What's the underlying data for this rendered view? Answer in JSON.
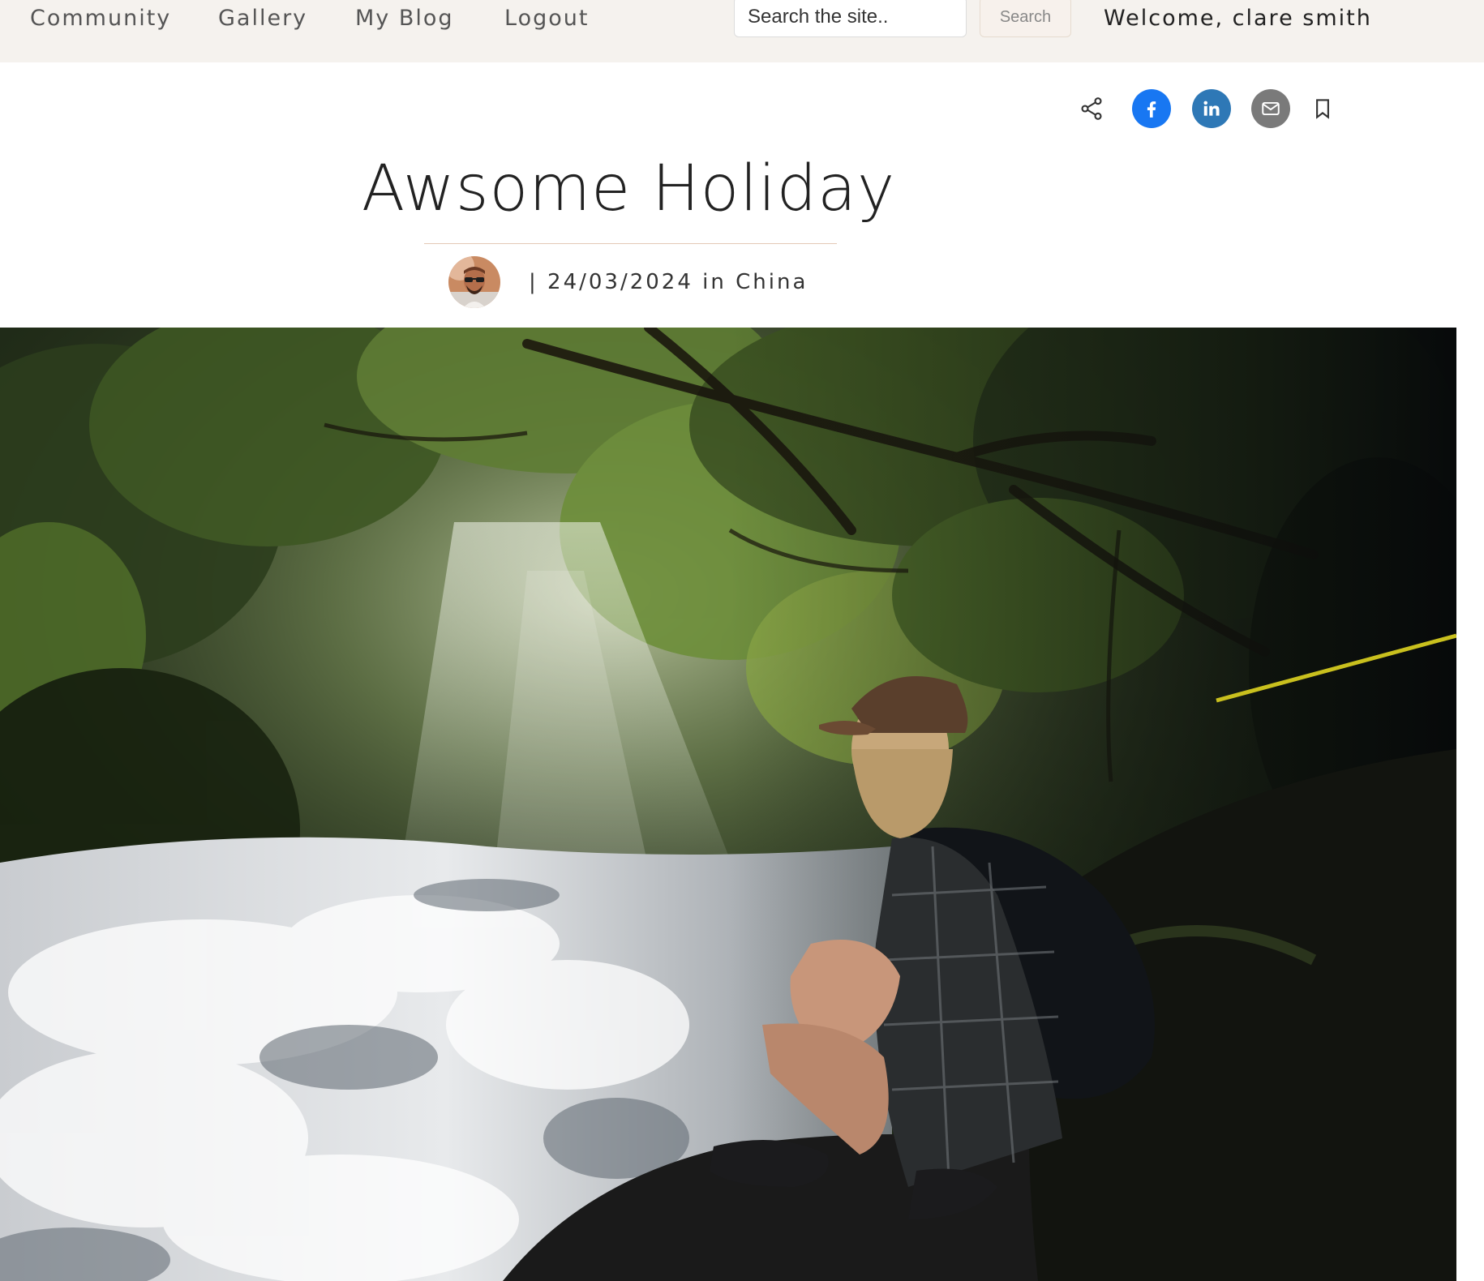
{
  "nav": {
    "items": [
      {
        "label": "Community"
      },
      {
        "label": "Gallery"
      },
      {
        "label": "My Blog"
      },
      {
        "label": "Logout"
      }
    ]
  },
  "search": {
    "placeholder": "Search the site..",
    "button_label": "Search"
  },
  "user": {
    "welcome": "Welcome, clare smith"
  },
  "share": {
    "icons": [
      "share-icon",
      "facebook-icon",
      "linkedin-icon",
      "email-icon",
      "bookmark-icon"
    ],
    "colors": {
      "facebook": "#1877f2",
      "linkedin": "#2e78b6",
      "email": "#7a7a7a"
    }
  },
  "post": {
    "title": "Awsome Holiday",
    "meta": "| 24/03/2024 in China"
  },
  "colors": {
    "topbar_bg": "#f5f2ee",
    "divider": "#e3c9b6"
  }
}
